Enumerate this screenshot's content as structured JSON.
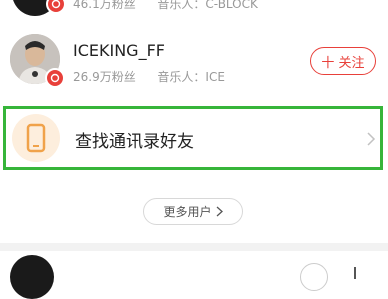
{
  "users": [
    {
      "followers": "46.1万粉丝",
      "musician_prefix": "音乐人：",
      "musician": "C-BLOCK"
    },
    {
      "name": "ICEKING_FF",
      "followers": "26.9万粉丝",
      "musician_prefix": "音乐人：",
      "musician": "ICE",
      "follow_label": "十 关注"
    }
  ],
  "contacts": {
    "label": "查找通讯录好友",
    "icon": "phone-icon"
  },
  "more": {
    "label": "更多用户"
  },
  "colors": {
    "accent": "#e8403a",
    "highlight_border": "#36b53a",
    "contacts_icon_bg": "#fdeedd",
    "contacts_icon": "#f0a24a"
  }
}
